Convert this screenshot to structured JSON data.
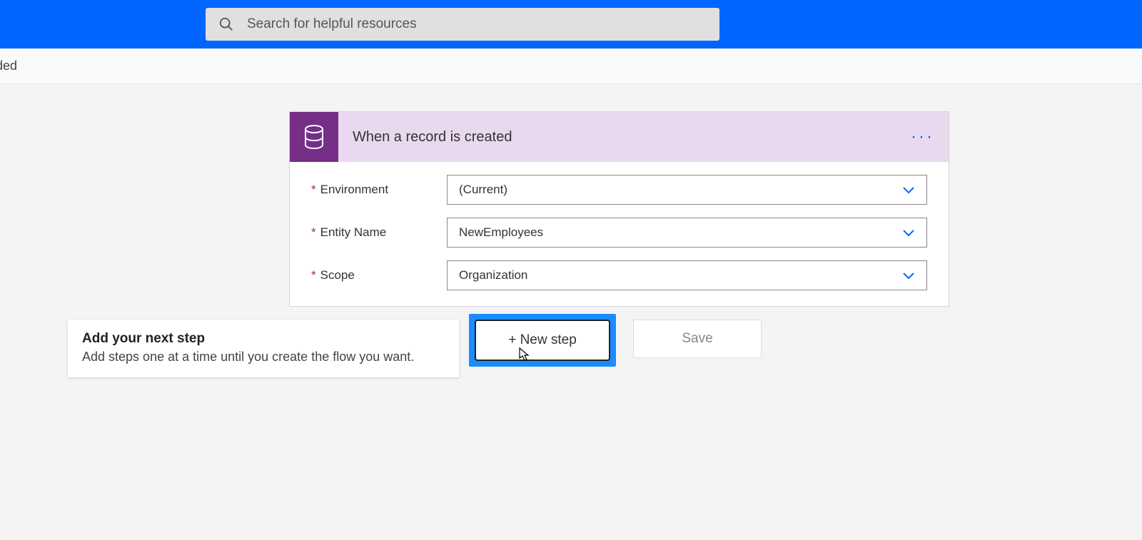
{
  "search": {
    "placeholder": "Search for helpful resources"
  },
  "subbar": {
    "text": "rded"
  },
  "trigger": {
    "title": "When a record is created",
    "fields": {
      "environment": {
        "label": "Environment",
        "value": "(Current)"
      },
      "entity": {
        "label": "Entity Name",
        "value": "NewEmployees"
      },
      "scope": {
        "label": "Scope",
        "value": "Organization"
      }
    }
  },
  "tooltip": {
    "title": "Add your next step",
    "desc": "Add steps one at a time until you create the flow you want."
  },
  "buttons": {
    "new_step": "+ New step",
    "save": "Save"
  },
  "colors": {
    "brand_blue": "#0066ff",
    "trigger_purple": "#762f87",
    "trigger_header_bg": "#e8d9ee"
  }
}
